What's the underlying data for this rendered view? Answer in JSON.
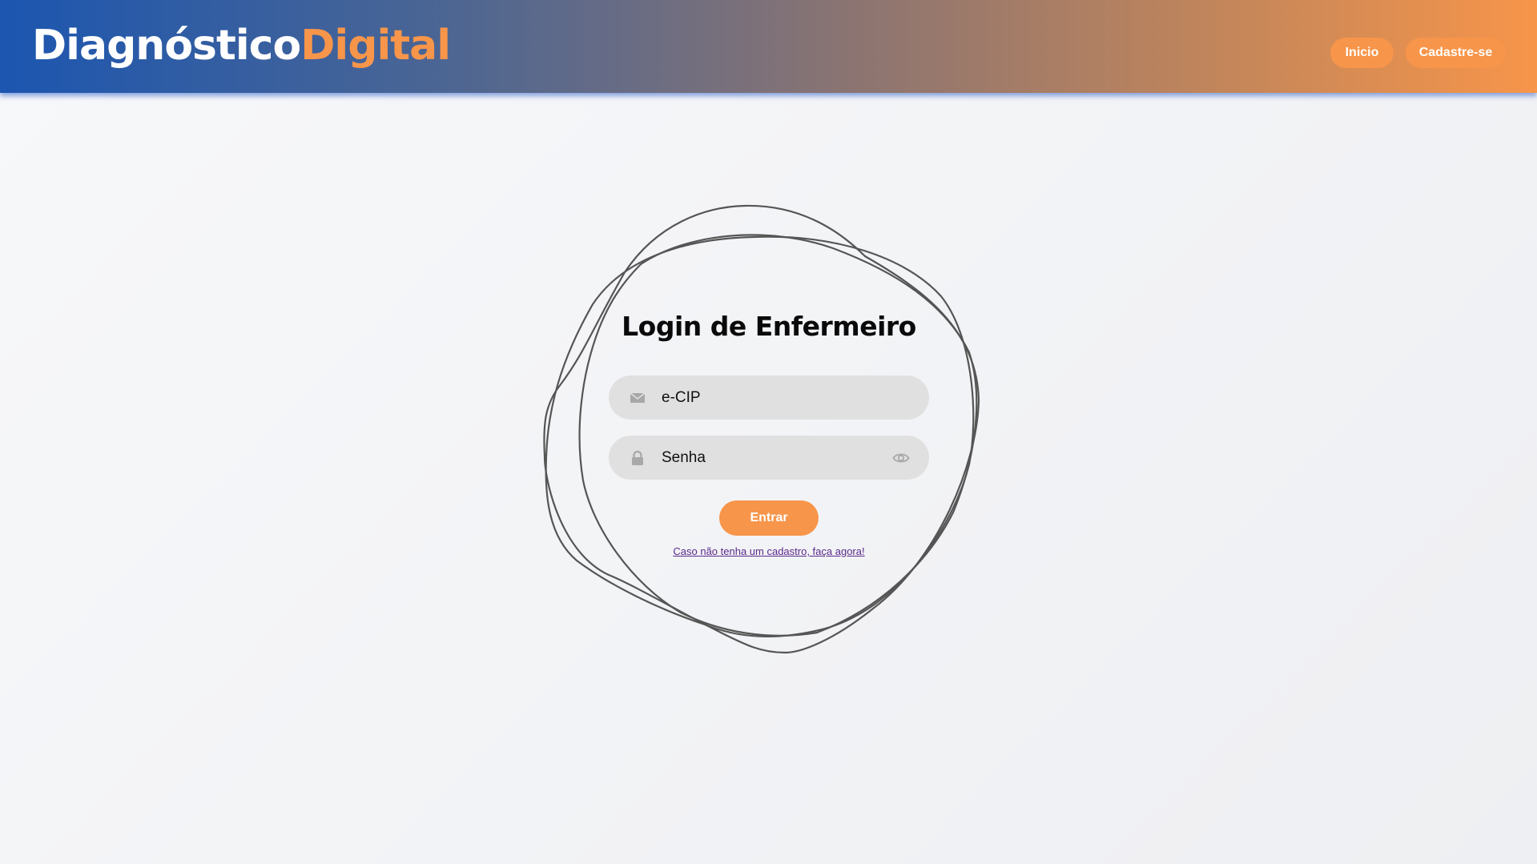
{
  "header": {
    "logo_part1": "Diagnóstico",
    "logo_part2": "Digital",
    "nav_home": "Inicio",
    "nav_register": "Cadastre-se"
  },
  "login": {
    "title": "Login de Enfermeiro",
    "email_placeholder": "e-CIP",
    "email_icon": "envelope-icon",
    "password_placeholder": "Senha",
    "password_icon": "lock-icon",
    "toggle_icon": "eye-icon",
    "submit_label": "Entrar",
    "signup_link": "Caso não tenha um cadastro, faça agora!"
  },
  "colors": {
    "accent": "#f7954a",
    "header_start": "#1c56b0",
    "header_end": "#f7954a",
    "field_bg": "#e0e0e0",
    "link": "#5a2a8c"
  }
}
